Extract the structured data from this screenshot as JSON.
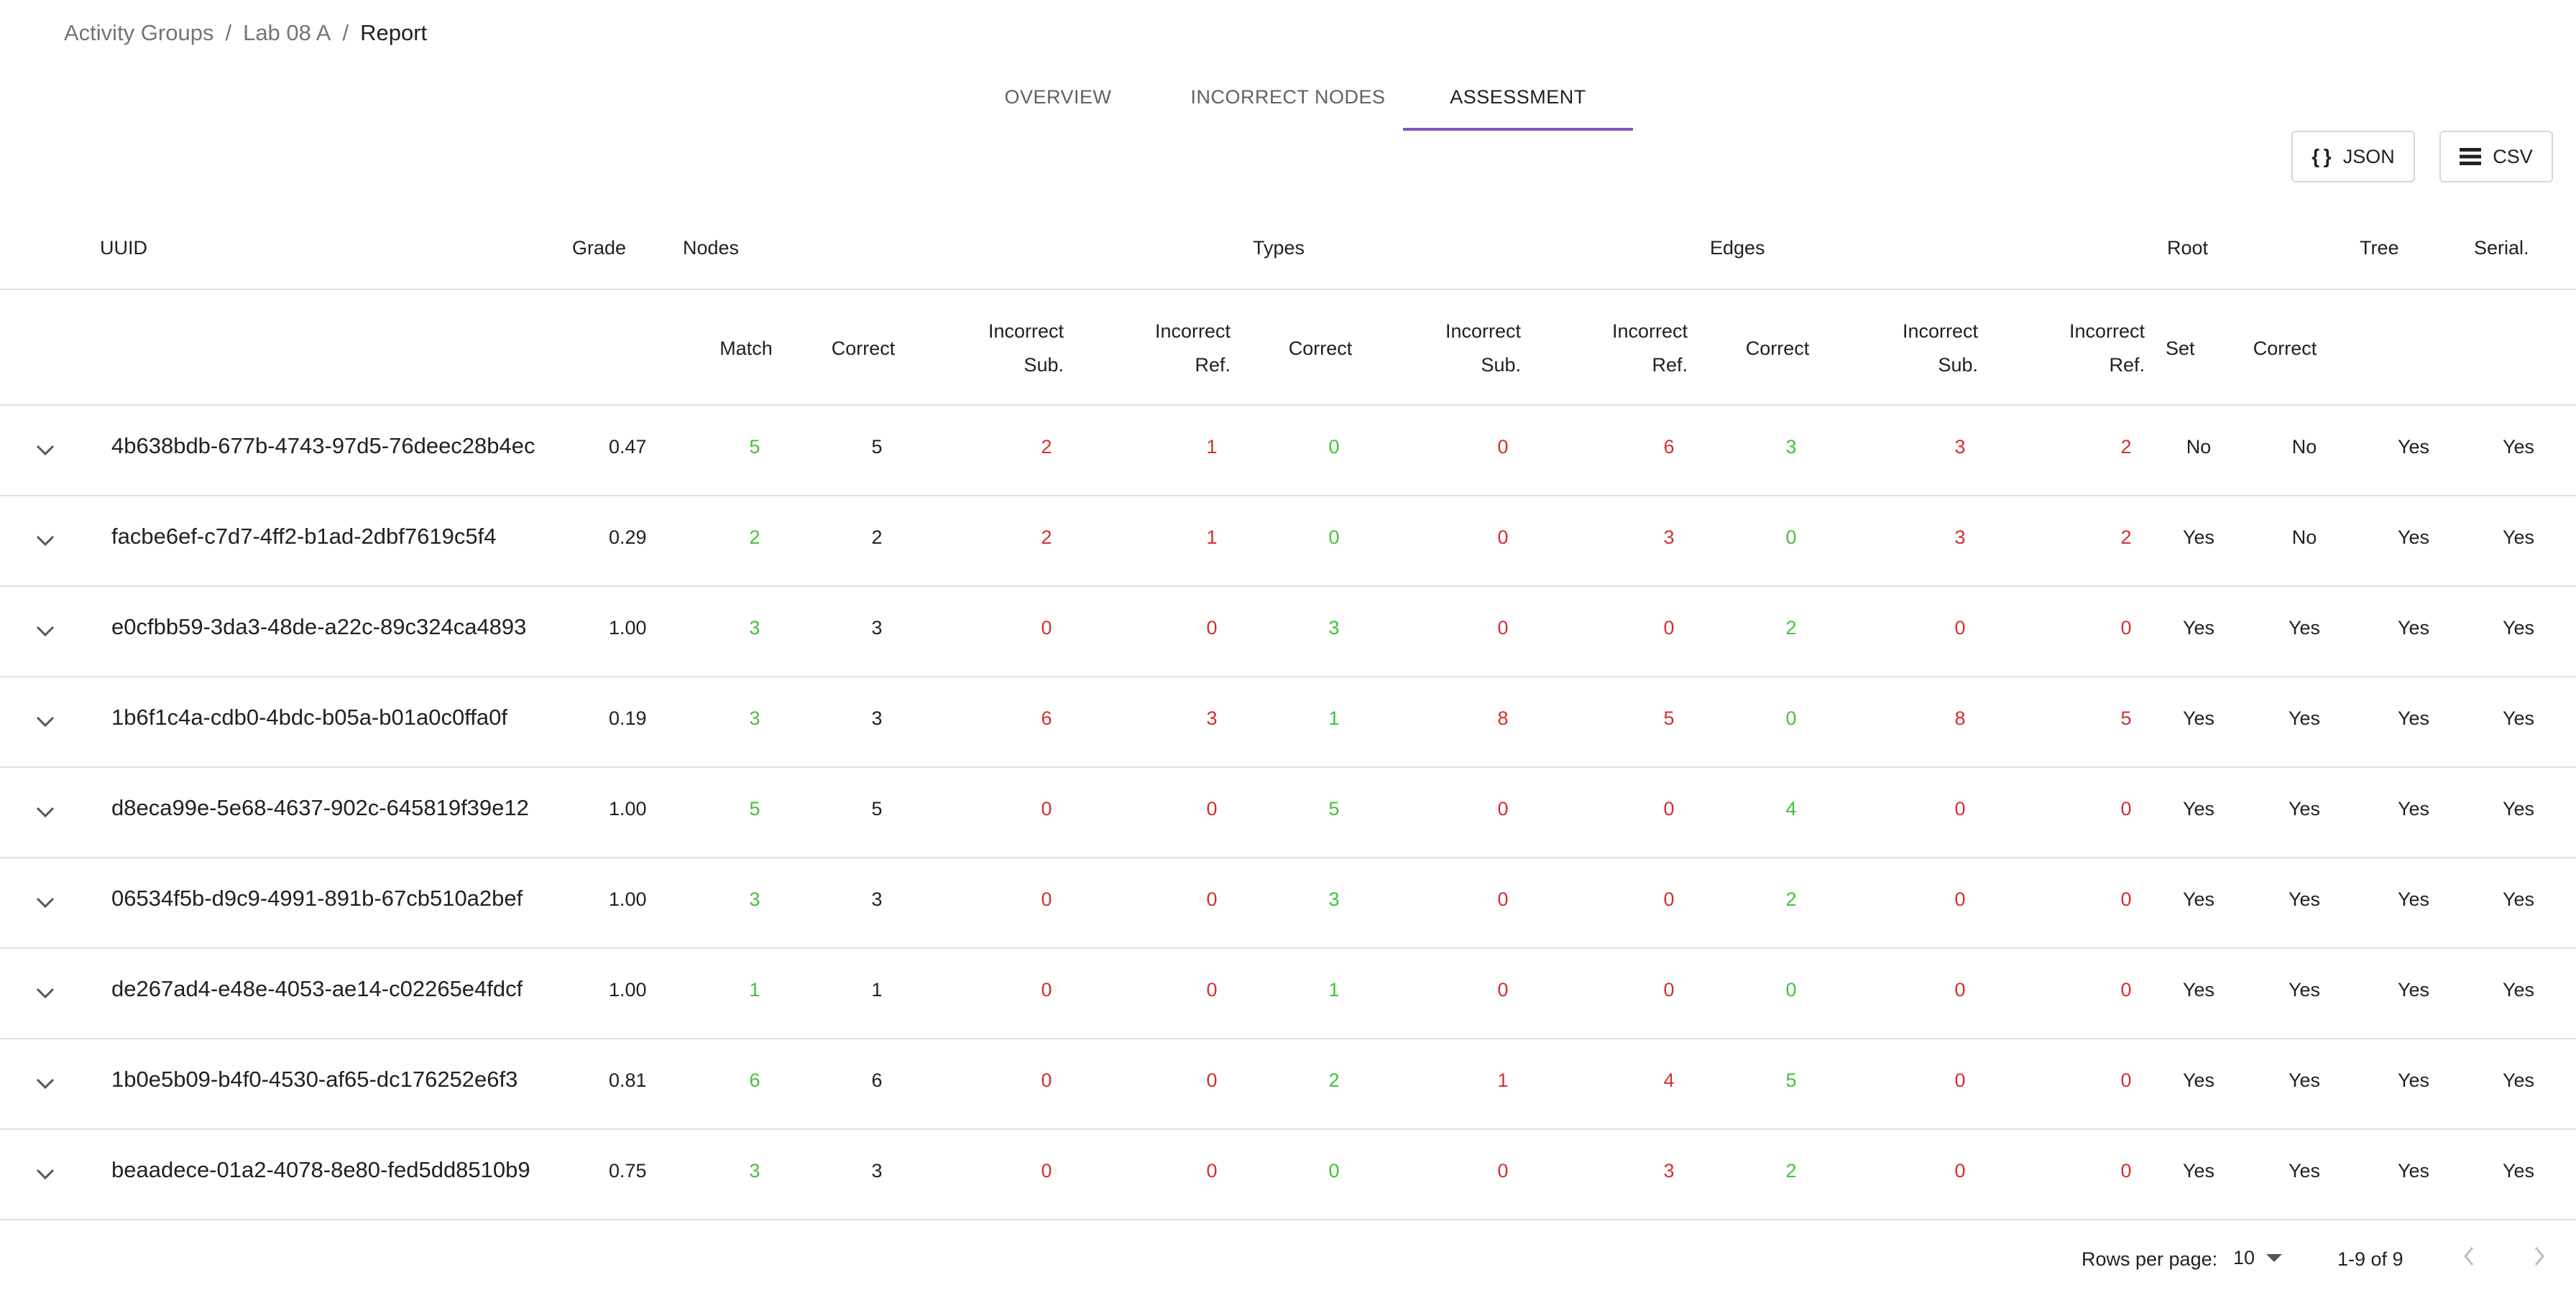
{
  "breadcrumb": {
    "items": [
      "Activity Groups",
      "Lab 08 A"
    ],
    "current": "Report",
    "separator": "/"
  },
  "tabs": [
    {
      "label": "OVERVIEW",
      "active": false
    },
    {
      "label": "INCORRECT NODES",
      "active": false
    },
    {
      "label": "ASSESSMENT",
      "active": true
    }
  ],
  "toolbar": {
    "json_label": "JSON",
    "csv_label": "CSV"
  },
  "table": {
    "group_headers": {
      "uuid": "UUID",
      "grade": "Grade",
      "nodes": "Nodes",
      "types": "Types",
      "edges": "Edges",
      "root": "Root",
      "tree": "Tree",
      "serial": "Serial."
    },
    "sub_headers": {
      "nodes_match": "Match",
      "nodes_correct": "Correct",
      "types_incorrect_sub": [
        "Incorrect",
        "Sub."
      ],
      "types_incorrect_ref": [
        "Incorrect",
        "Ref."
      ],
      "types_correct": "Correct",
      "edges_incorrect_sub": [
        "Incorrect",
        "Sub."
      ],
      "edges_incorrect_ref": [
        "Incorrect",
        "Ref."
      ],
      "edges_correct": "Correct",
      "root_incorrect_sub": [
        "Incorrect",
        "Sub."
      ],
      "root_incorrect_ref": [
        "Incorrect",
        "Ref."
      ],
      "root_set": "Set",
      "root_correct": "Correct"
    },
    "rows": [
      {
        "uuid": "4b638bdb-677b-4743-97d5-76deec28b4ec",
        "grade": "0.47",
        "vals": [
          "5",
          "5",
          "2",
          "1",
          "0",
          "0",
          "6",
          "3",
          "3",
          "2"
        ],
        "root_set": "No",
        "root_correct": "No",
        "tree": "Yes",
        "serial": "Yes"
      },
      {
        "uuid": "facbe6ef-c7d7-4ff2-b1ad-2dbf7619c5f4",
        "grade": "0.29",
        "vals": [
          "2",
          "2",
          "2",
          "1",
          "0",
          "0",
          "3",
          "0",
          "3",
          "2"
        ],
        "root_set": "Yes",
        "root_correct": "No",
        "tree": "Yes",
        "serial": "Yes"
      },
      {
        "uuid": "e0cfbb59-3da3-48de-a22c-89c324ca4893",
        "grade": "1.00",
        "vals": [
          "3",
          "3",
          "0",
          "0",
          "3",
          "0",
          "0",
          "2",
          "0",
          "0"
        ],
        "root_set": "Yes",
        "root_correct": "Yes",
        "tree": "Yes",
        "serial": "Yes"
      },
      {
        "uuid": "1b6f1c4a-cdb0-4bdc-b05a-b01a0c0ffa0f",
        "grade": "0.19",
        "vals": [
          "3",
          "3",
          "6",
          "3",
          "1",
          "8",
          "5",
          "0",
          "8",
          "5"
        ],
        "root_set": "Yes",
        "root_correct": "Yes",
        "tree": "Yes",
        "serial": "Yes"
      },
      {
        "uuid": "d8eca99e-5e68-4637-902c-645819f39e12",
        "grade": "1.00",
        "vals": [
          "5",
          "5",
          "0",
          "0",
          "5",
          "0",
          "0",
          "4",
          "0",
          "0"
        ],
        "root_set": "Yes",
        "root_correct": "Yes",
        "tree": "Yes",
        "serial": "Yes"
      },
      {
        "uuid": "06534f5b-d9c9-4991-891b-67cb510a2bef",
        "grade": "1.00",
        "vals": [
          "3",
          "3",
          "0",
          "0",
          "3",
          "0",
          "0",
          "2",
          "0",
          "0"
        ],
        "root_set": "Yes",
        "root_correct": "Yes",
        "tree": "Yes",
        "serial": "Yes"
      },
      {
        "uuid": "de267ad4-e48e-4053-ae14-c02265e4fdcf",
        "grade": "1.00",
        "vals": [
          "1",
          "1",
          "0",
          "0",
          "1",
          "0",
          "0",
          "0",
          "0",
          "0"
        ],
        "root_set": "Yes",
        "root_correct": "Yes",
        "tree": "Yes",
        "serial": "Yes"
      },
      {
        "uuid": "1b0e5b09-b4f0-4530-af65-dc176252e6f3",
        "grade": "0.81",
        "vals": [
          "6",
          "6",
          "0",
          "0",
          "2",
          "1",
          "4",
          "5",
          "0",
          "0"
        ],
        "root_set": "Yes",
        "root_correct": "Yes",
        "tree": "Yes",
        "serial": "Yes"
      },
      {
        "uuid": "beaadece-01a2-4078-8e80-fed5dd8510b9",
        "grade": "0.75",
        "vals": [
          "3",
          "3",
          "0",
          "0",
          "0",
          "0",
          "3",
          "2",
          "0",
          "0"
        ],
        "root_set": "Yes",
        "root_correct": "Yes",
        "tree": "Yes",
        "serial": "Yes"
      }
    ]
  },
  "pagination": {
    "rows_per_page_label": "Rows per page:",
    "rows_per_page": "10",
    "range": "1-9 of 9"
  },
  "colors": {
    "accent": "#7e57c2",
    "positive": "#43c13a",
    "negative": "#d32f2f",
    "divider": "#e0e0e0"
  }
}
